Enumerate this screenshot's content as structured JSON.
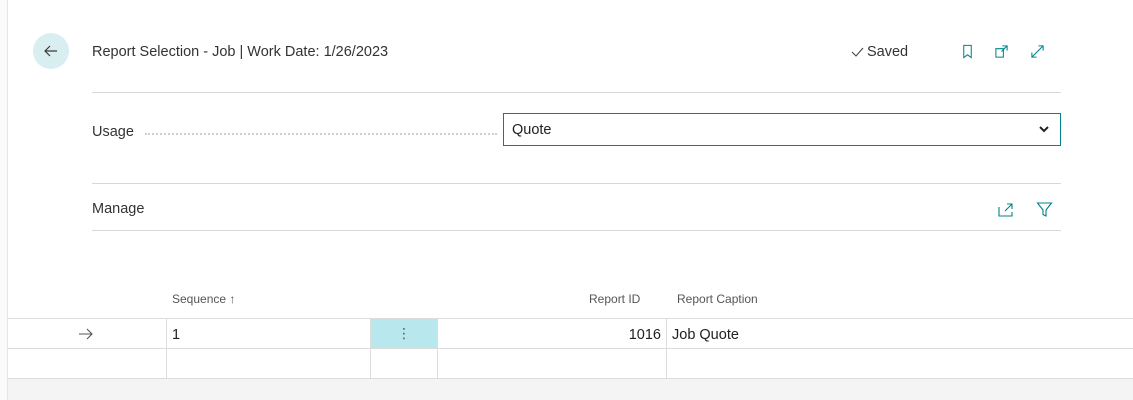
{
  "header": {
    "title": "Report Selection - Job | Work Date: 1/26/2023",
    "status": "Saved",
    "icons": [
      "back-arrow-icon",
      "bookmark-icon",
      "open-new-window-icon",
      "expand-icon"
    ]
  },
  "usage": {
    "label": "Usage",
    "selected": "Quote"
  },
  "actions": {
    "manage_label": "Manage",
    "icons": [
      "share-icon",
      "filter-icon"
    ]
  },
  "table": {
    "columns": [
      "Sequence ↑",
      "Report ID",
      "Report Caption"
    ],
    "rows": [
      {
        "sequence": "1",
        "report_id": "1016",
        "report_caption": "Job Quote"
      }
    ]
  },
  "colors": {
    "accent": "#00838a",
    "back_button_bg": "#d9eef1",
    "selected_cell_bg": "#b9e7ee"
  }
}
